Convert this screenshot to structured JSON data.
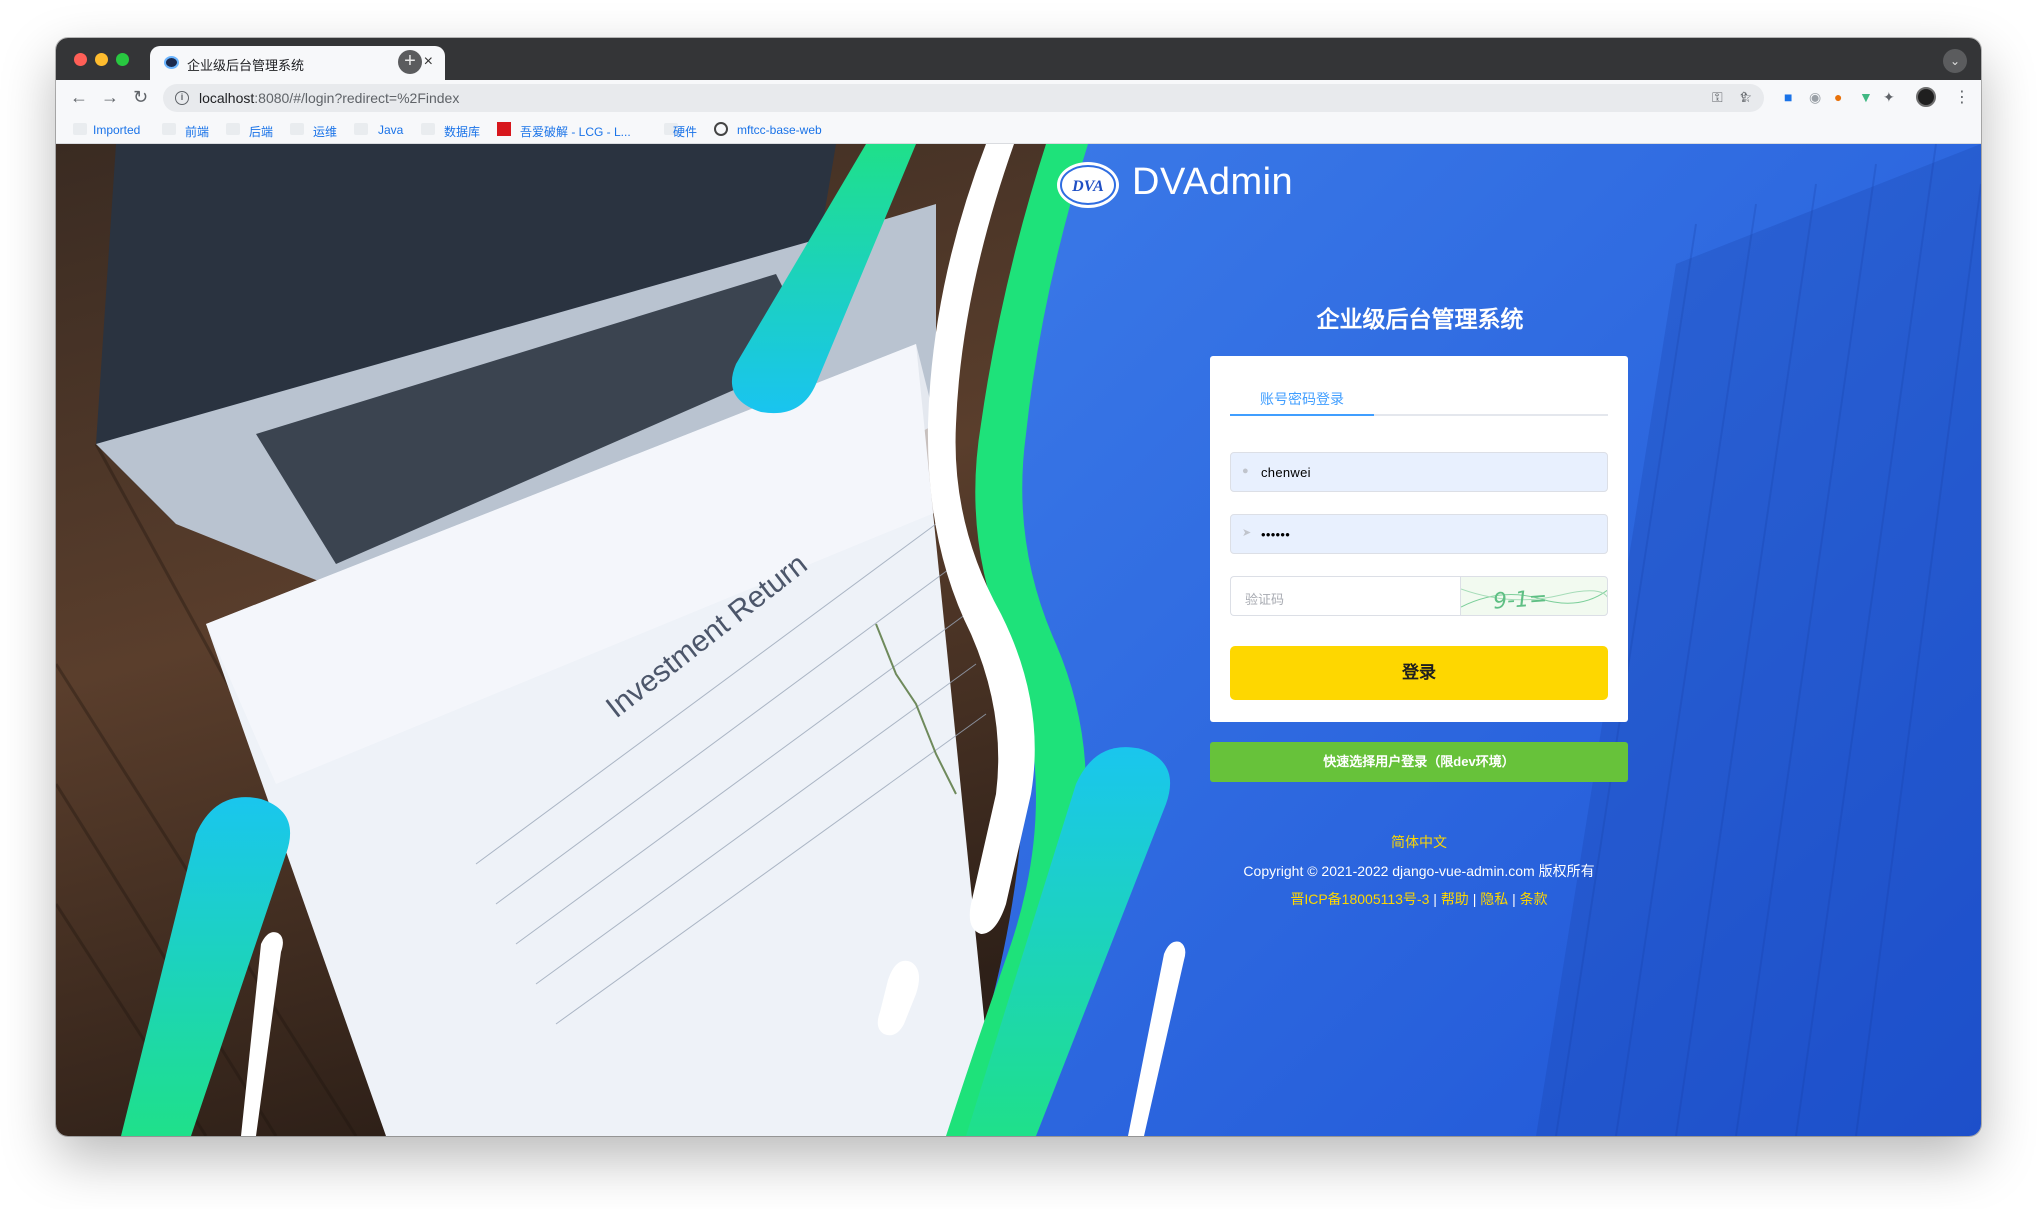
{
  "browser": {
    "tab_title": "企业级后台管理系统",
    "url_host": "localhost",
    "url_rest": ":8080/#/login?redirect=%2Findex",
    "bookmarks": [
      "Imported",
      "前端",
      "后端",
      "运维",
      "Java",
      "数据库",
      "吾爱破解 - LCG - L...",
      "硬件",
      "mftcc-base-web"
    ]
  },
  "brand": {
    "logo_text": "DVA",
    "name": "DVAdmin"
  },
  "login": {
    "system_title": "企业级后台管理系统",
    "tab_label": "账号密码登录",
    "username_value": "chenwei",
    "password_mask": "••••••",
    "captcha_placeholder": "验证码",
    "captcha_text": "9-1=",
    "submit_label": "登录",
    "quick_login_label": "快速选择用户登录（限dev环境）"
  },
  "footer": {
    "language": "简体中文",
    "copyright": "Copyright © 2021-2022 django-vue-admin.com 版权所有",
    "icp": "晋ICP备18005113号-3",
    "help": "帮助",
    "privacy": "隐私",
    "terms": "条款",
    "separator": " | "
  },
  "photo_text": {
    "heading": "Investment Return"
  },
  "colors": {
    "primary_blue": "#2f6de1",
    "login_button": "#fed700",
    "quick_button": "#67c23a",
    "tab_active": "#409eff"
  }
}
